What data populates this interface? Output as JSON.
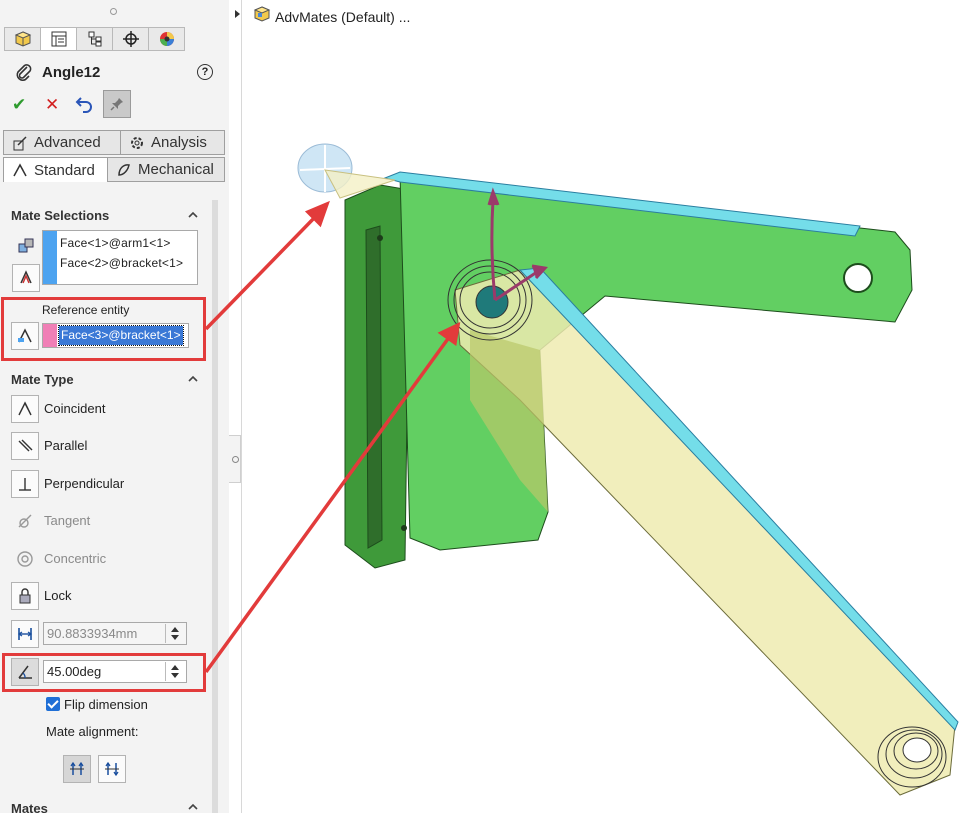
{
  "property_manager": {
    "tabs": [
      "FeatureManager",
      "PropertyManager",
      "ConfigurationManager",
      "DimXpertManager",
      "DisplayManager"
    ],
    "title": "Angle12",
    "help_label": "?",
    "ok_label": "✔",
    "cancel_label": "✕",
    "mate_tabs": {
      "advanced": "Advanced",
      "analysis": "Analysis",
      "standard": "Standard",
      "mechanical": "Mechanical"
    },
    "colors": {
      "selection_stripe": "#4da3f0",
      "reference_stripe": "#f07fb6",
      "highlight": "#e23b3b"
    },
    "mate_selections": {
      "title": "Mate Selections",
      "entities": [
        "Face<1>@arm1<1>",
        "Face<2>@bracket<1>"
      ],
      "reference_entity_label": "Reference entity",
      "reference_entity_value": "Face<3>@bracket<1>"
    },
    "mate_type": {
      "title": "Mate Type",
      "options": [
        {
          "label": "Coincident",
          "enabled": true
        },
        {
          "label": "Parallel",
          "enabled": true
        },
        {
          "label": "Perpendicular",
          "enabled": true
        },
        {
          "label": "Tangent",
          "enabled": false
        },
        {
          "label": "Concentric",
          "enabled": false
        },
        {
          "label": "Lock",
          "enabled": true
        }
      ],
      "distance_value": "90.8833934mm",
      "angle_value": "45.00deg",
      "flip_dimension_label": "Flip dimension",
      "flip_dimension_checked": true,
      "mate_alignment_label": "Mate alignment:"
    },
    "mates_title": "Mates"
  },
  "feature_tree": {
    "root_label": "AdvMates (Default) ..."
  }
}
